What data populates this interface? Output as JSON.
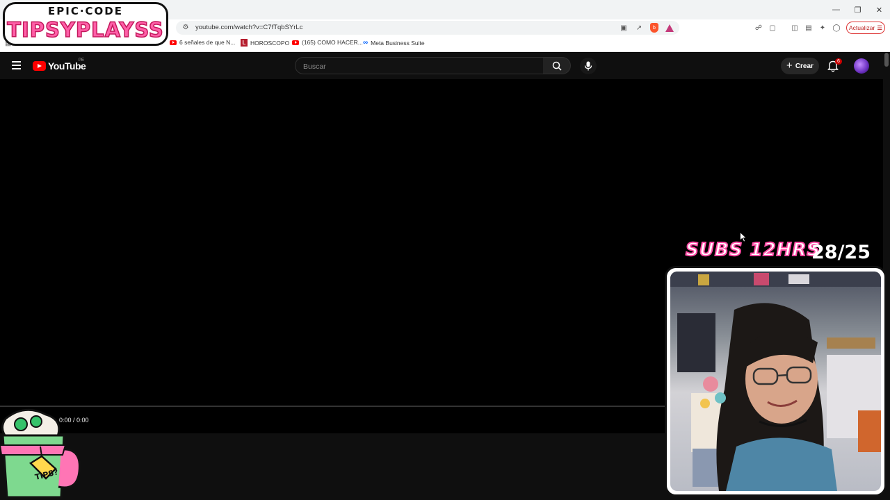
{
  "overlay": {
    "brand_top": "EPIC·CODE",
    "brand_main": "TIPSYPLAYSS",
    "subs_label": "SUBS 12HRS",
    "subs_count": "28/25",
    "mascot_tag": "TIPS?"
  },
  "browser": {
    "url": "youtube.com/watch?v=C7fTqbSYrLc",
    "update_label": "Actualizar",
    "bookmarks": [
      {
        "label": "6 señales de que N...",
        "icon": "youtube-favicon"
      },
      {
        "label": "HOROSCOPO",
        "icon": "horoscopo-favicon"
      },
      {
        "label": "(165) COMO HACER...",
        "icon": "youtube-favicon"
      },
      {
        "label": "Meta Business Suite",
        "icon": "meta-favicon"
      }
    ]
  },
  "youtube": {
    "logo_text": "YouTube",
    "region": "PE",
    "search_placeholder": "Buscar",
    "create_label": "Crear",
    "notification_count": "6",
    "time_display": "0:00 / 0:00"
  },
  "colors": {
    "brand_pink": "#ff5fa8",
    "youtube_red": "#ff0000",
    "update_red": "#d33333",
    "yt_bg": "#0f0f0f"
  }
}
